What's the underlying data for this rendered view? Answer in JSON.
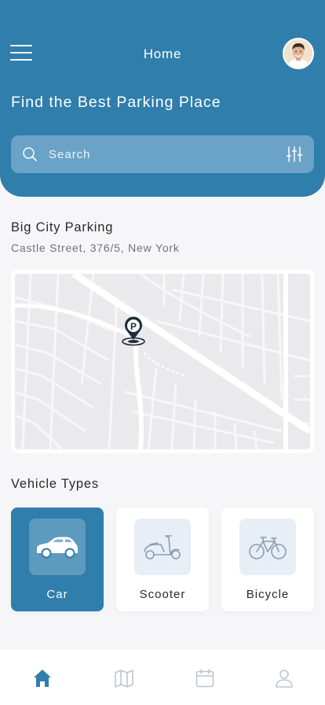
{
  "header": {
    "title": "Home",
    "headline": "Find the Best Parking Place",
    "menu_icon": "hamburger-menu-icon",
    "avatar_icon": "user-avatar"
  },
  "search": {
    "placeholder": "Search",
    "value": "",
    "icon": "search-icon",
    "filter_icon": "sliders-filter-icon"
  },
  "place": {
    "name": "Big City Parking",
    "address": "Castle Street, 376/5, New York",
    "marker_icon": "parking-pin-icon"
  },
  "vehicles": {
    "title": "Vehicle Types",
    "items": [
      {
        "label": "Car",
        "icon": "car-icon",
        "selected": true
      },
      {
        "label": "Scooter",
        "icon": "scooter-icon",
        "selected": false
      },
      {
        "label": "Bicycle",
        "icon": "bicycle-icon",
        "selected": false
      }
    ]
  },
  "nav": {
    "items": [
      {
        "icon": "home-icon",
        "active": true
      },
      {
        "icon": "map-icon",
        "active": false
      },
      {
        "icon": "calendar-icon",
        "active": false
      },
      {
        "icon": "profile-icon",
        "active": false
      }
    ]
  },
  "colors": {
    "primary": "#2f7eac",
    "search_bg": "#6ba3c8",
    "card_bg": "#ffffff",
    "icon_tile": "#e7eef6",
    "nav_inactive": "#b9c6d3"
  }
}
